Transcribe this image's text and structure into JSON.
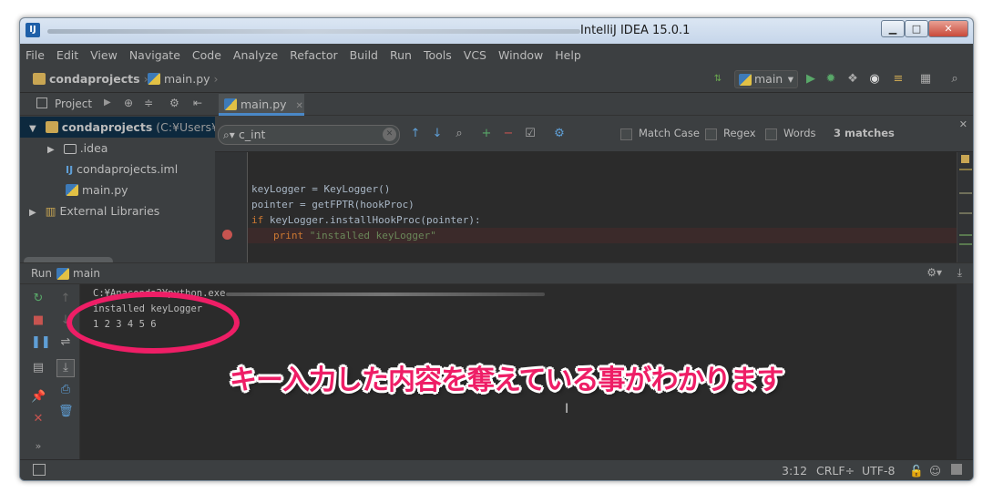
{
  "window": {
    "title": "IntelliJ IDEA 15.0.1",
    "controls": {
      "minimize": "▁",
      "maximize": "□",
      "close": "✕"
    }
  },
  "menu": [
    "File",
    "Edit",
    "View",
    "Navigate",
    "Code",
    "Analyze",
    "Refactor",
    "Build",
    "Run",
    "Tools",
    "VCS",
    "Window",
    "Help"
  ],
  "breadcrumb": {
    "project": "condaprojects",
    "file": "main.py"
  },
  "toolbar": {
    "run_config": "main"
  },
  "project_panel": {
    "header": "Project",
    "tree": [
      {
        "label": "condaprojects",
        "extra": "(C:¥Users¥y",
        "expanded": true
      },
      {
        "label": ".idea",
        "expanded": false
      },
      {
        "label": "condaprojects.iml"
      },
      {
        "label": "main.py"
      },
      {
        "label": "External Libraries",
        "expanded": false
      }
    ]
  },
  "editor": {
    "tab": "main.py",
    "search": {
      "value": "c_int",
      "match_case": "Match Case",
      "regex": "Regex",
      "words": "Words",
      "matches": "3 matches"
    },
    "lines": {
      "l1": "keyLogger = KeyLogger()",
      "l2": "pointer = getFPTR(hookProc)",
      "l3_kw": "if",
      "l3_rest": " keyLogger.installHookProc(pointer):",
      "l4_kw": "print",
      "l4_str": " \"installed keyLogger\""
    }
  },
  "run_panel": {
    "title": "Run",
    "config": "main",
    "console": [
      "C:¥Anaconda2¥python.exe",
      "installed keyLogger",
      "1 2 3 4 5 6"
    ]
  },
  "status_bar": {
    "position": "3:12",
    "line_sep": "CRLF÷",
    "encoding": "UTF-8"
  },
  "annotation": {
    "text": "キー入力した内容を奪えている事がわかります",
    "color": "#ee1e66"
  }
}
